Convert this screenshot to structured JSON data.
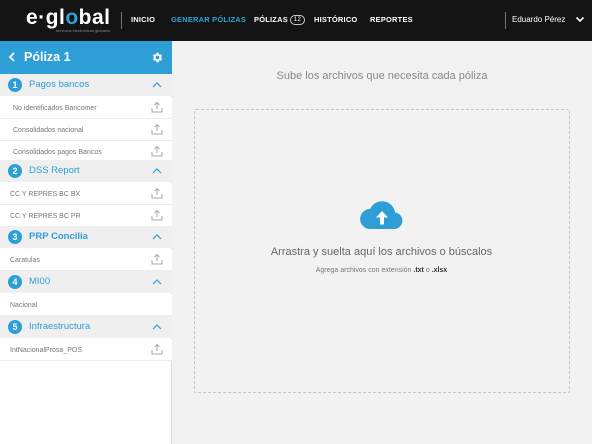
{
  "header": {
    "logo": {
      "part1": "e·gl",
      "part2": "o",
      "part3": "bal",
      "tagline": "servicios electrónicos globales"
    },
    "nav": [
      {
        "label": "INICIO"
      },
      {
        "label": "GENERAR PÓLIZAS",
        "active": true
      },
      {
        "label": "PÓLIZAS",
        "badge": "12"
      },
      {
        "label": "HISTÓRICO"
      },
      {
        "label": "REPORTES"
      }
    ],
    "user": {
      "name": "Eduardo Pérez"
    }
  },
  "sidebar": {
    "title": "Póliza 1",
    "sections": [
      {
        "number": "1",
        "label": "Pagos bancos",
        "files": [
          "No identificados Bancomer",
          "Consolidados nacional",
          "Consolidados pagos Bancos"
        ]
      },
      {
        "number": "2",
        "label": "DSS Report",
        "files": [
          "CC Y REPRES BC BX",
          "CC Y REPRES BC PR"
        ]
      },
      {
        "number": "3",
        "label": "PRP Concilia",
        "files": [
          "Caratulas"
        ]
      },
      {
        "number": "4",
        "label": "MI00",
        "files": [
          "Nacional"
        ]
      },
      {
        "number": "5",
        "label": "Infraestructura",
        "files": [
          "IntNacionalProsa_POS"
        ]
      }
    ]
  },
  "main": {
    "title": "Sube los archivos que necesita cada póliza",
    "dropzone": {
      "text": "Arrastra y suelta aquí los archivos o búscalos",
      "hint_prefix": "Agrega archivos con extensión",
      "ext1": ".txt",
      "hint_or": "o",
      "ext2": ".xlsx"
    }
  },
  "colors": {
    "accent": "#2e9fd6",
    "topbar": "#141414",
    "section_bg": "#efefef"
  },
  "icons": [
    "chevron-left-icon",
    "gear-icon",
    "chevron-up-icon",
    "upload-icon",
    "cloud-upload-icon",
    "chevron-down-icon"
  ]
}
